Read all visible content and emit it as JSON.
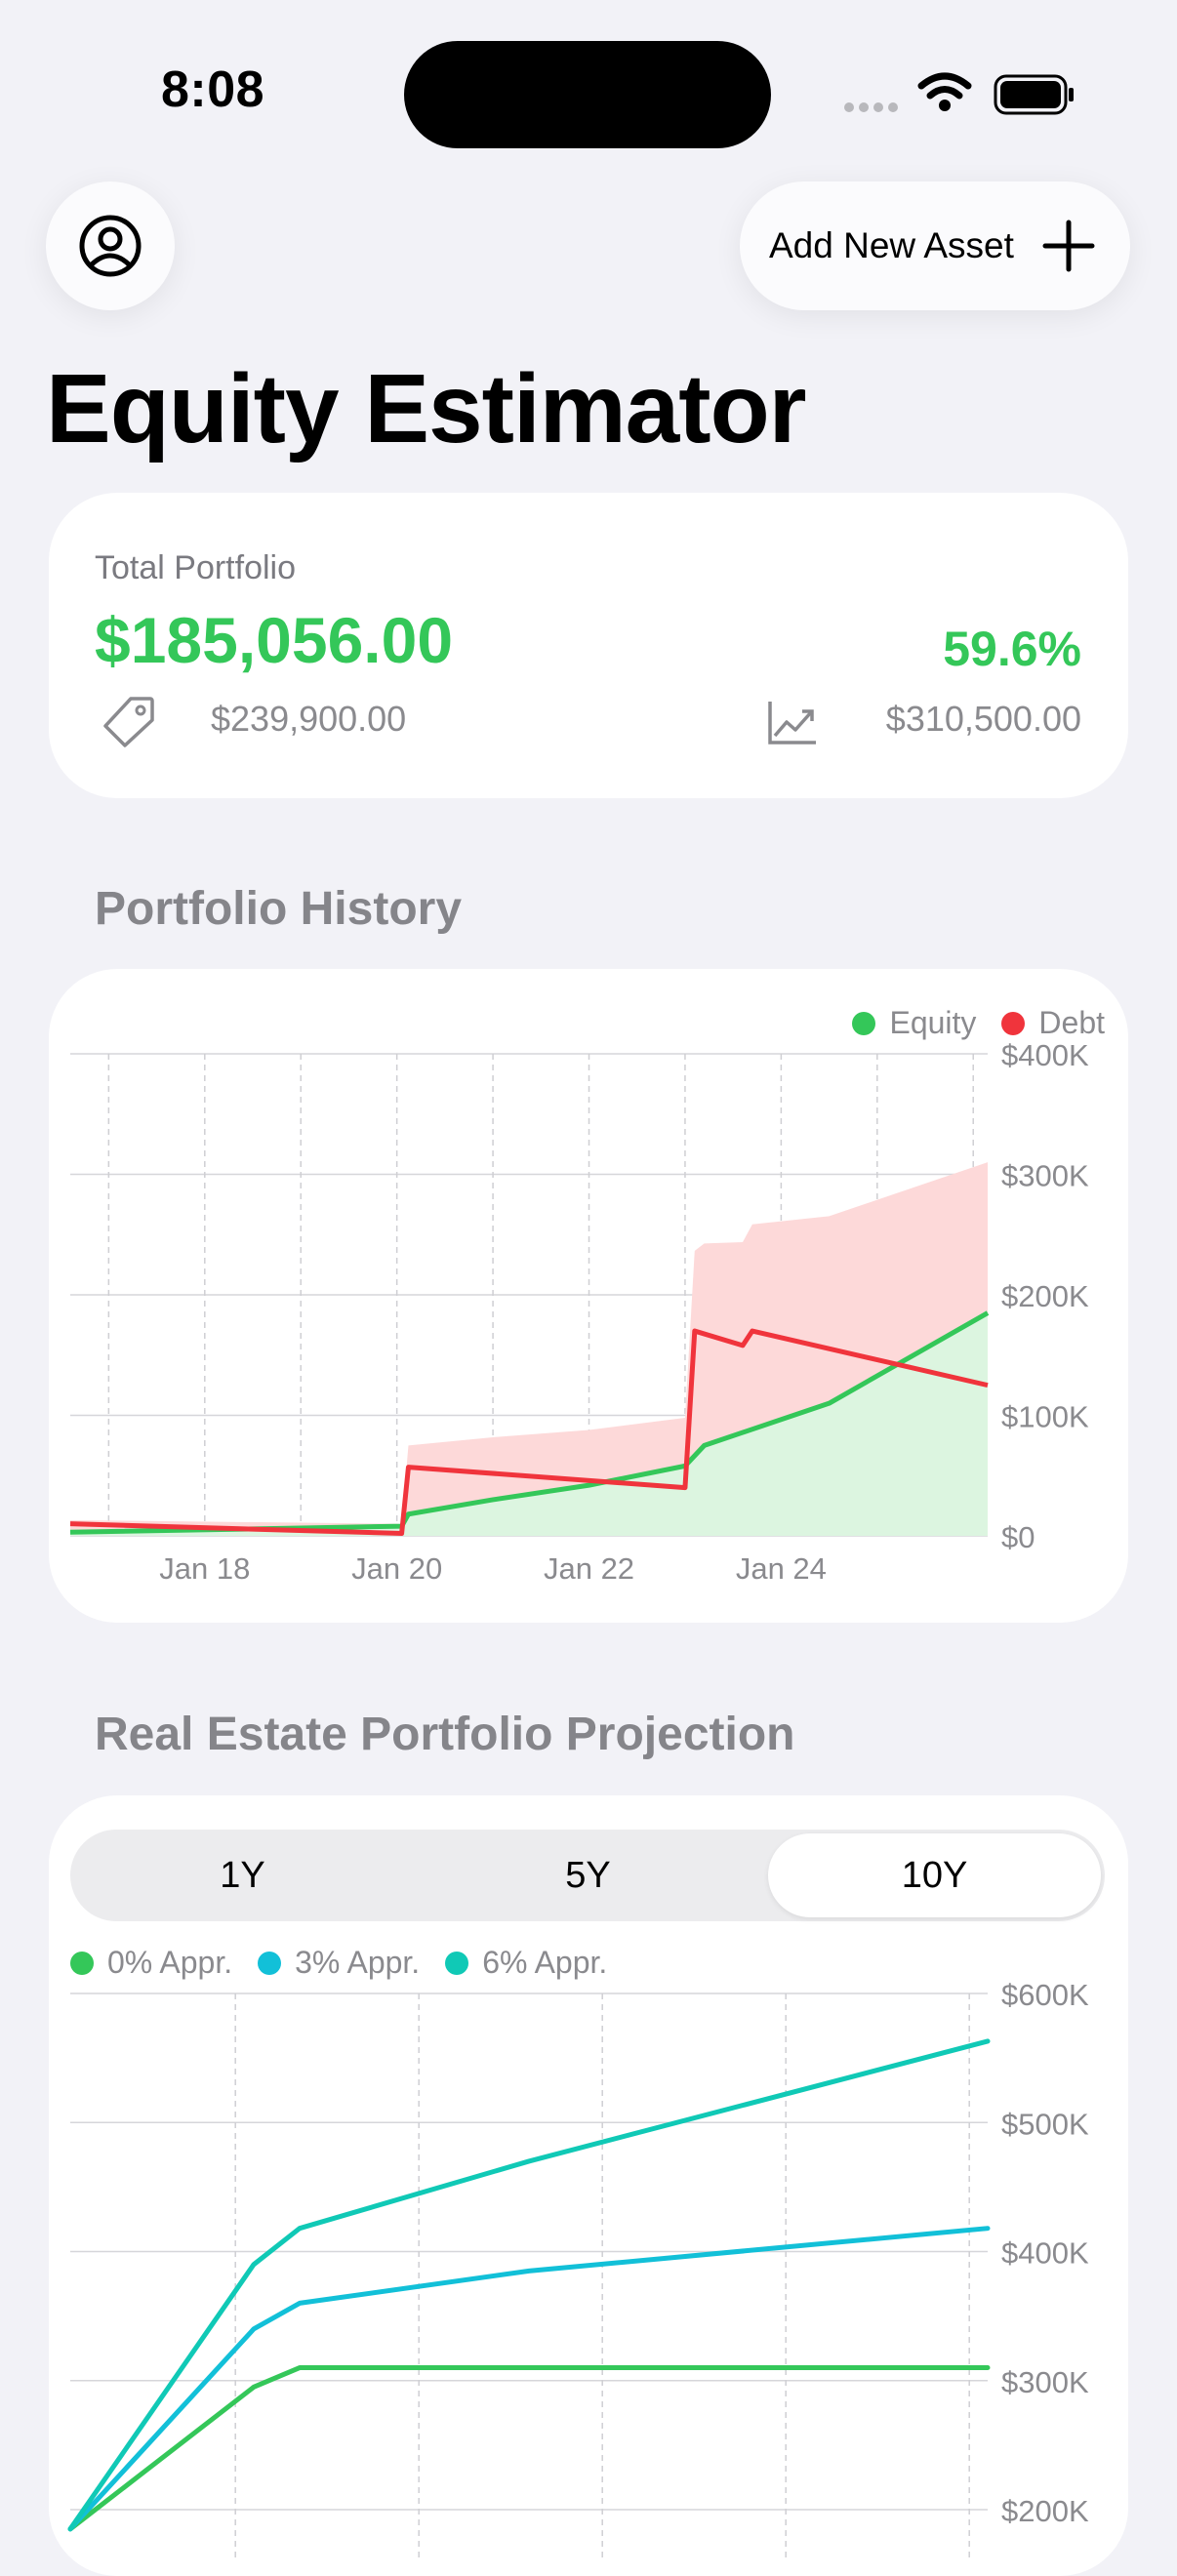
{
  "status_bar": {
    "time": "8:08"
  },
  "header": {
    "add_asset_label": "Add New Asset",
    "title": "Equity Estimator"
  },
  "summary": {
    "label": "Total Portfolio",
    "total": "$185,056.00",
    "percent": "59.6%",
    "purchase_value": "$239,900.00",
    "current_value": "$310,500.00",
    "icons": [
      "tag-icon",
      "chart-trend-icon"
    ]
  },
  "colors": {
    "equity": "#34c759",
    "debt": "#f0343c",
    "appr0": "#34c759",
    "appr3": "#12c0d8",
    "appr6": "#10c9b6"
  },
  "history": {
    "section_title": "Portfolio History",
    "chart_data": {
      "type": "area",
      "title": "",
      "x_labels": [
        "Jan 18",
        "Jan 20",
        "Jan 22",
        "Jan 24"
      ],
      "y_labels": [
        "$400K",
        "$300K",
        "$200K",
        "$100K",
        "$0"
      ],
      "ylim": [
        0,
        400000
      ],
      "xlim": [
        2016.6,
        2026.15
      ],
      "legend_position": "top-right",
      "grid": true,
      "series": [
        {
          "name": "Equity",
          "x": [
            2016.6,
            2020.05,
            2020.12,
            2021.0,
            2022.0,
            2023.0,
            2023.2,
            2024.5,
            2026.15
          ],
          "values": [
            3000,
            8000,
            18000,
            30000,
            42000,
            58000,
            75000,
            110000,
            185000
          ]
        },
        {
          "name": "Debt",
          "x": [
            2016.6,
            2020.05,
            2020.12,
            2023.0,
            2023.1,
            2023.6,
            2023.7,
            2026.15
          ],
          "values": [
            10000,
            2000,
            57000,
            40000,
            170000,
            158000,
            170000,
            125000
          ]
        }
      ]
    }
  },
  "projection": {
    "section_title": "Real Estate Portfolio Projection",
    "tabs": [
      "1Y",
      "5Y",
      "10Y"
    ],
    "selected_tab": "10Y",
    "chart_data": {
      "type": "line",
      "title": "",
      "y_labels": [
        "$600K",
        "$500K",
        "$400K",
        "$300K",
        "$200K"
      ],
      "ylim": [
        200000,
        600000
      ],
      "legend_position": "top-left",
      "grid": true,
      "series": [
        {
          "name": "0% Appr.",
          "x": [
            0,
            2,
            2.5,
            5,
            10
          ],
          "values": [
            185000,
            295000,
            310000,
            310000,
            310000
          ]
        },
        {
          "name": "3% Appr.",
          "x": [
            0,
            2,
            2.5,
            5,
            10
          ],
          "values": [
            185000,
            340000,
            360000,
            385000,
            418000
          ]
        },
        {
          "name": "6% Appr.",
          "x": [
            0,
            2,
            2.5,
            5,
            10
          ],
          "values": [
            185000,
            390000,
            418000,
            470000,
            563000
          ]
        }
      ]
    }
  }
}
